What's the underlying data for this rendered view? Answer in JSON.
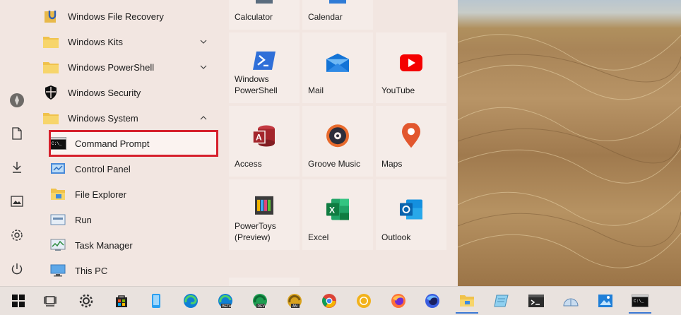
{
  "start_menu": {
    "app_list": [
      {
        "label": "Windows File Recovery",
        "icon": "file-recovery-icon"
      },
      {
        "label": "Windows Kits",
        "icon": "folder-icon",
        "expandable": true
      },
      {
        "label": "Windows PowerShell",
        "icon": "folder-icon",
        "expandable": true
      },
      {
        "label": "Windows Security",
        "icon": "shield-icon"
      },
      {
        "label": "Windows System",
        "icon": "folder-icon",
        "expanded": true
      },
      {
        "label": "Command Prompt",
        "icon": "command-prompt-icon",
        "highlighted": true
      },
      {
        "label": "Control Panel",
        "icon": "control-panel-icon"
      },
      {
        "label": "File Explorer",
        "icon": "file-explorer-icon"
      },
      {
        "label": "Run",
        "icon": "run-icon"
      },
      {
        "label": "Task Manager",
        "icon": "task-manager-icon"
      },
      {
        "label": "This PC",
        "icon": "this-pc-icon"
      }
    ],
    "tiles": [
      {
        "label": "Calculator",
        "icon": "calculator-icon"
      },
      {
        "label": "Calendar",
        "icon": "calendar-icon"
      },
      {
        "label": "Windows\nPowerShell",
        "icon": "powershell-icon"
      },
      {
        "label": "Mail",
        "icon": "mail-icon"
      },
      {
        "label": "YouTube",
        "icon": "youtube-icon"
      },
      {
        "label": "Access",
        "icon": "access-icon"
      },
      {
        "label": "Groove Music",
        "icon": "groove-music-icon"
      },
      {
        "label": "Maps",
        "icon": "maps-icon"
      },
      {
        "label": "PowerToys\n(Preview)",
        "icon": "powertoys-icon"
      },
      {
        "label": "Excel",
        "icon": "excel-icon"
      },
      {
        "label": "Outlook",
        "icon": "outlook-icon"
      }
    ],
    "rail": [
      "user-avatar-icon",
      "documents-icon",
      "downloads-icon",
      "pictures-icon",
      "settings-icon",
      "power-icon"
    ]
  },
  "taskbar": {
    "items": [
      "start-icon",
      "task-view-icon",
      "settings-icon",
      "store-icon",
      "phone-icon",
      "edge-icon",
      "edge-beta-icon",
      "edge-dev-icon",
      "edge-canary-icon",
      "chrome-icon",
      "chrome-canary-icon",
      "firefox-icon",
      "firefox-nightly-icon",
      "file-explorer-icon",
      "notepad-icon",
      "terminal-icon",
      "snip-icon",
      "photos-icon",
      "command-prompt-icon"
    ]
  },
  "colors": {
    "highlight": "#d6202c",
    "background": "#f2e6e1",
    "taskbar": "#e9e2de"
  }
}
